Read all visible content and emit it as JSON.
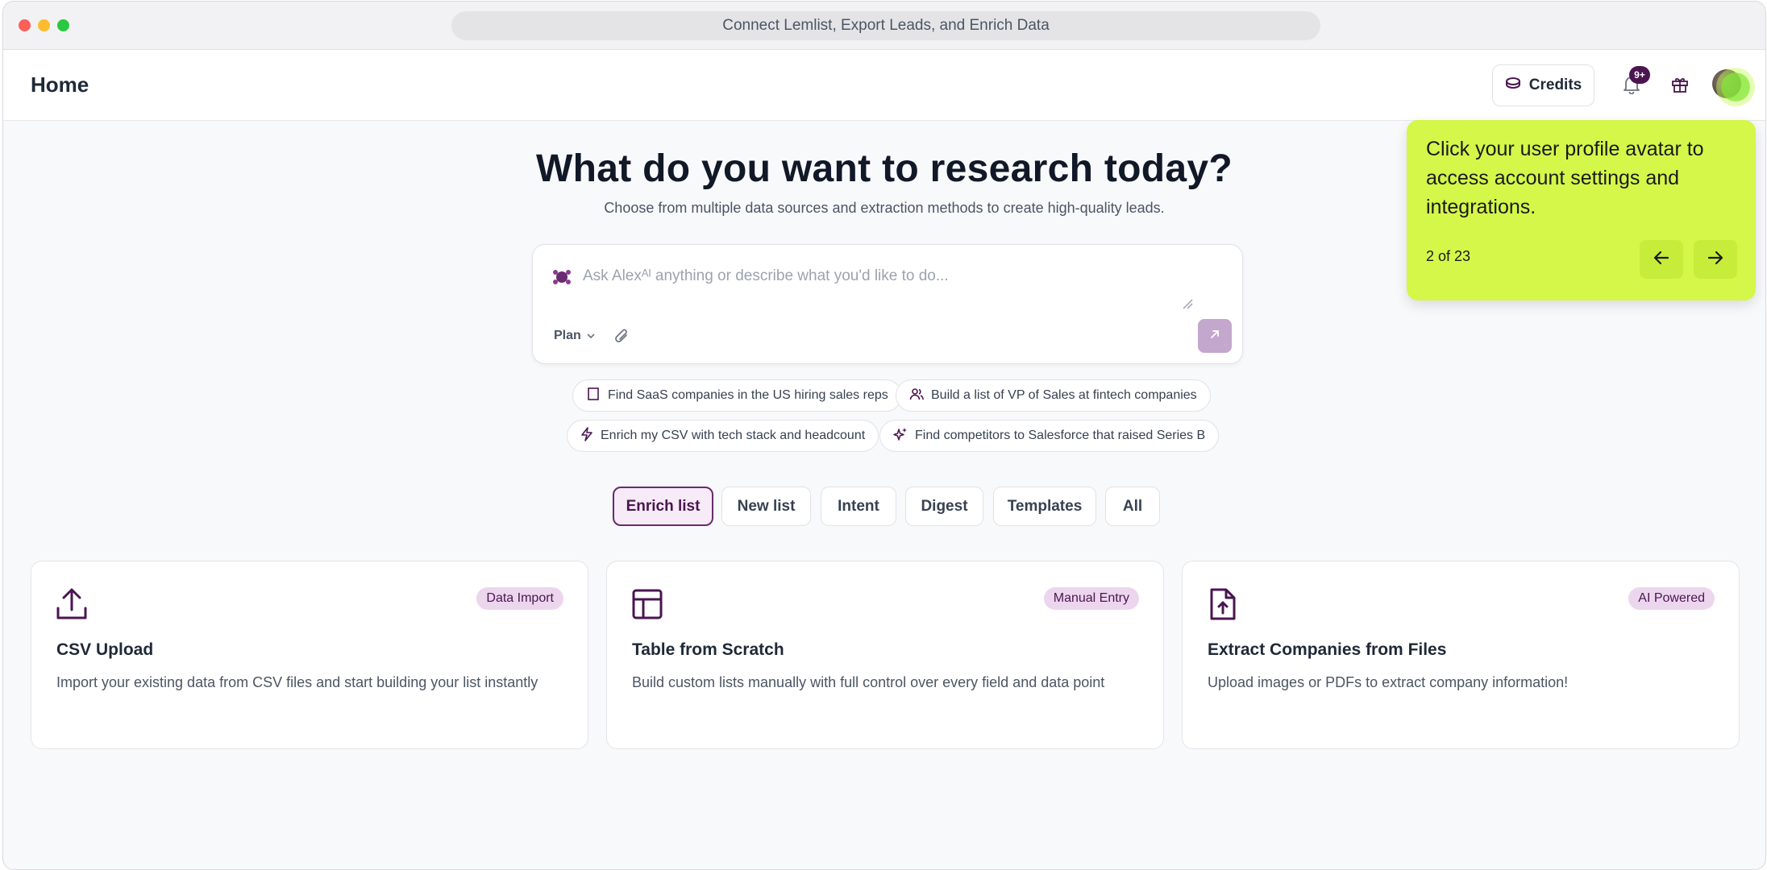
{
  "browser": {
    "url_title": "Connect Lemlist, Export Leads, and Enrich Data"
  },
  "header": {
    "title": "Home",
    "credits_label": "Credits",
    "notification_count": "9+",
    "icons": [
      "coins-icon",
      "bell-icon",
      "gift-icon",
      "avatar"
    ]
  },
  "hero": {
    "title": "What do you want to research today?",
    "subtitle": "Choose from multiple data sources and extraction methods to create high-quality leads."
  },
  "prompt": {
    "placeholder": "Ask Alexᴬᴵ anything or describe what you'd like to do...",
    "plan_label": "Plan"
  },
  "suggestions": [
    {
      "label": "Find SaaS companies in the US hiring sales reps",
      "icon": "building-icon"
    },
    {
      "label": "Build a list of VP of Sales at fintech companies",
      "icon": "users-icon"
    },
    {
      "label": "Enrich my CSV with tech stack and headcount",
      "icon": "lightning-icon"
    },
    {
      "label": "Find competitors to Salesforce that raised Series B",
      "icon": "sparkles-icon"
    }
  ],
  "tabs": [
    {
      "label": "Enrich list",
      "active": true
    },
    {
      "label": "New list",
      "active": false
    },
    {
      "label": "Intent",
      "active": false
    },
    {
      "label": "Digest",
      "active": false
    },
    {
      "label": "Templates",
      "active": false
    },
    {
      "label": "All",
      "active": false
    }
  ],
  "cards": [
    {
      "title": "CSV Upload",
      "badge": "Data Import",
      "description": "Import your existing data from CSV files and start building your list instantly",
      "icon": "upload-icon"
    },
    {
      "title": "Table from Scratch",
      "badge": "Manual Entry",
      "description": "Build custom lists manually with full control over every field and data point",
      "icon": "table-icon"
    },
    {
      "title": "Extract Companies from Files",
      "badge": "AI Powered",
      "description": "Upload images or PDFs to extract company information!",
      "icon": "file-upload-icon"
    }
  ],
  "tour": {
    "text": "Click your user profile avatar to access account settings and integrations.",
    "step": "2 of 23"
  },
  "colors": {
    "brand": "#4a1550",
    "tour_bg": "#d4f74a",
    "badge_bg": "#ecd6ee"
  }
}
